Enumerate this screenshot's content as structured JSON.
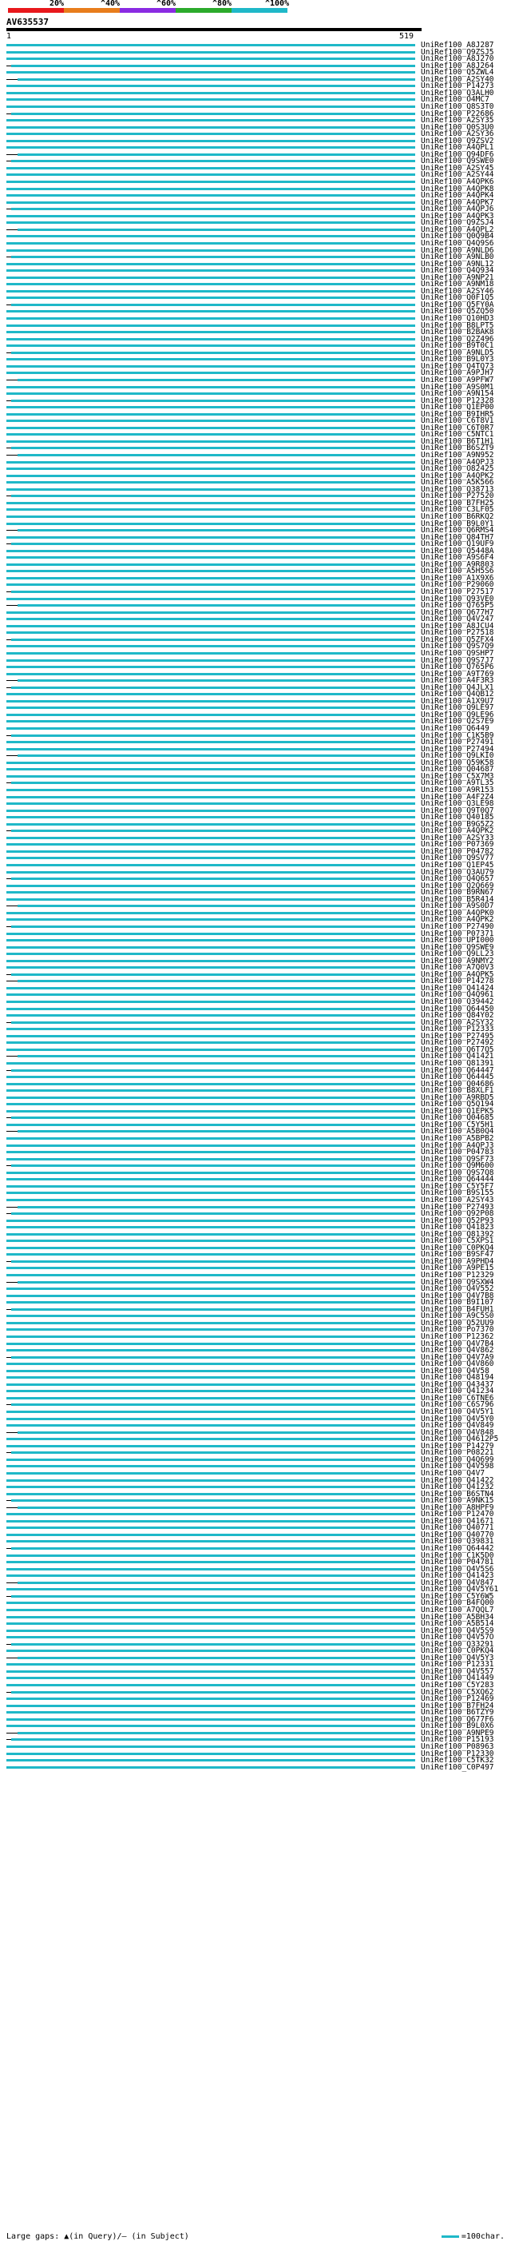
{
  "scale": {
    "labels": [
      "20%",
      "^40%",
      "^60%",
      "^80%",
      "^100%"
    ],
    "colors": [
      "#e8181c",
      "#e87d1c",
      "#8a2be2",
      "#2caa2c",
      "#1fb8c8"
    ]
  },
  "query": {
    "name": "AV635537",
    "start": "1",
    "end": "519"
  },
  "legend": {
    "large_gaps": "Large gaps: ▲(in Query)/– (in Subject)",
    "scale": "=100char."
  },
  "hits": [
    "UniRef100_A8J287",
    "UniRef100_Q9ZSJ5",
    "UniRef100_A8J270",
    "UniRef100_A8J264",
    "UniRef100_Q5ZWL4",
    "UniRef100_A2SY40",
    "UniRef100_P14273",
    "UniRef100_Q3ALH0",
    "UniRef100_O4MC7",
    "UniRef100_Q8S3T0",
    "UniRef100_P22686",
    "UniRef100_A2SY35",
    "UniRef100_Q0S3U0",
    "UniRef100_A2SY36",
    "UniRef100_Q9ZSV2",
    "UniRef100_A4QPL1",
    "UniRef100_Q94DF6",
    "UniRef100_Q9SWE0",
    "UniRef100_A2SY45",
    "UniRef100_A2SY44",
    "UniRef100_A4QPK6",
    "UniRef100_A4QPK8",
    "UniRef100_A4QPK4",
    "UniRef100_A4QPK7",
    "UniRef100_A4QPJ6",
    "UniRef100_A4QPK3",
    "UniRef100_Q9ZSJ4",
    "UniRef100_A4QPL2",
    "UniRef100_Q0Q9B4",
    "UniRef100_Q4Q9S6",
    "UniRef100_A9NLD6",
    "UniRef100_A9NLB0",
    "UniRef100_A9NL12",
    "UniRef100_Q4Q934",
    "UniRef100_A9NP21",
    "UniRef100_A9NM18",
    "UniRef100_A2SY46",
    "UniRef100_Q0F1Q5",
    "UniRef100_Q5FY0A",
    "UniRef100_Q5ZQ50",
    "UniRef100_Q10HD3",
    "UniRef100_B8LPT5",
    "UniRef100_B2BAK8",
    "UniRef100_Q2Z496",
    "UniRef100_B9T0C1",
    "UniRef100_A9NLD5",
    "UniRef100_B9L0Y3",
    "UniRef100_Q4TQ73",
    "UniRef100_A9PJH7",
    "UniRef100_A9PFW7",
    "UniRef100_A9S0M1",
    "UniRef100_A9N154",
    "UniRef100_P12328",
    "UniRef100_Q1EP00",
    "UniRef100_B9IHR5",
    "UniRef100_C6T8V1",
    "UniRef100_C6T0R7",
    "UniRef100_C5NTC1",
    "UniRef100_B6T1H1",
    "UniRef100_B6SZT9",
    "UniRef100_A9N952",
    "UniRef100_A4QPJ3",
    "UniRef100_O82425",
    "UniRef100_A4QPK2",
    "UniRef100_A5K566",
    "UniRef100_Q38713",
    "UniRef100_P27520",
    "UniRef100_B7FH25",
    "UniRef100_C3LF05",
    "UniRef100_B6RKQ2",
    "UniRef100_B9L0Y1",
    "UniRef100_Q6RMS4",
    "UniRef100_Q84TH7",
    "UniRef100_Q19UF9",
    "UniRef100_Q5448A",
    "UniRef100_A9S6F4",
    "UniRef100_A9R803",
    "UniRef100_A5H5S6",
    "UniRef100_A1X9X6",
    "UniRef100_P29060",
    "UniRef100_P27517",
    "UniRef100_Q93VE0",
    "UniRef100_Q765P5",
    "UniRef100_Q677H7",
    "UniRef100_Q4V247",
    "UniRef100_A8JCU4",
    "UniRef100_P27518",
    "UniRef100_Q5ZFX4",
    "UniRef100_Q9S7Q9",
    "UniRef100_Q9SHP7",
    "UniRef100_Q9S7J7",
    "UniRef100_Q765P6",
    "UniRef100_A9T769",
    "UniRef100_A4F3R3",
    "UniRef100_Q4JLX1",
    "UniRef100_Q4QB12",
    "UniRef100_A1X9U7",
    "UniRef100_Q9LE97",
    "UniRef100_Q9LE96",
    "UniRef100_Q2S7E9",
    "UniRef100_Q6449",
    "UniRef100_C1K5B9",
    "UniRef100_P27491",
    "UniRef100_P27494",
    "UniRef100_Q9LKI0",
    "UniRef100_Q59K58",
    "UniRef100_Q04687",
    "UniRef100_C5X7M3",
    "UniRef100_A9TL35",
    "UniRef100_A9R153",
    "UniRef100_A4F2Z4",
    "UniRef100_Q3LE98",
    "UniRef100_Q9T0Q7",
    "UniRef100_Q40185",
    "UniRef100_B9G5Z2",
    "UniRef100_A4QPK2",
    "UniRef100_A2SY33",
    "UniRef100_P07369",
    "UniRef100_P04782",
    "UniRef100_Q9SV77",
    "UniRef100_Q1EP45",
    "UniRef100_Q3AU79",
    "UniRef100_Q4Q657",
    "UniRef100_Q2Q669",
    "UniRef100_B9RN67",
    "UniRef100_B5R414",
    "UniRef100_A9S0D7",
    "UniRef100_A4QPK0",
    "UniRef100_A4QPK2",
    "UniRef100_P27490",
    "UniRef100_P07371",
    "UniRef100_UPI000",
    "UniRef100_Q9SWE9",
    "UniRef100_Q9LL23",
    "UniRef100_A9NMY2",
    "UniRef100_A7Q0V3",
    "UniRef100_A4QPK5",
    "UniRef100_P14278",
    "UniRef100_Q41424",
    "UniRef100_Q4Q961",
    "UniRef100_Q39442",
    "UniRef100_Q64450",
    "UniRef100_Q84Y02",
    "UniRef100_A2SY32",
    "UniRef100_P12333",
    "UniRef100_P27495",
    "UniRef100_P27492",
    "UniRef100_Q6T7Q5",
    "UniRef100_Q41421",
    "UniRef100_Q81391",
    "UniRef100_Q64447",
    "UniRef100_Q64445",
    "UniRef100_Q04686",
    "UniRef100_B8XLF1",
    "UniRef100_A9RBD5",
    "UniRef100_Q5Q194",
    "UniRef100_Q1EPK5",
    "UniRef100_Q04685",
    "UniRef100_C5Y5H1",
    "UniRef100_A5B0Q4",
    "UniRef100_A5BPB2",
    "UniRef100_A4QPJ3",
    "UniRef100_P04783",
    "UniRef100_Q9SF73",
    "UniRef100_Q9M600",
    "UniRef100_Q9S7Q8",
    "UniRef100_Q64444",
    "UniRef100_C5Y5F7",
    "UniRef100_B9S155",
    "UniRef100_A2SY43",
    "UniRef100_P27493",
    "UniRef100_Q92P08",
    "UniRef100_Q52P93",
    "UniRef100_Q41823",
    "UniRef100_Q81392",
    "UniRef100_C5XPS1",
    "UniRef100_C0PKQ4",
    "UniRef100_B9SF47",
    "UniRef100_A9PHD4",
    "UniRef100_A9PE15",
    "UniRef100_P12329",
    "UniRef100_Q9SXW4",
    "UniRef100_Q4V552",
    "UniRef100_Q4V7B8",
    "UniRef100_B9I107",
    "UniRef100_B4FUH1",
    "UniRef100_A9C5S0",
    "UniRef100_Q52UU9",
    "UniRef100_Po7370",
    "UniRef100_P12362",
    "UniRef100_Q4V7B4",
    "UniRef100_Q4V862",
    "UniRef100_Q4V7A9",
    "UniRef100_Q4V860",
    "UniRef100_Q4V58",
    "UniRef100_Q48194",
    "UniRef100_Q43437",
    "UniRef100_Q41234",
    "UniRef100_C6TNE6",
    "UniRef100_C6S796",
    "UniRef100_Q4V5Y1",
    "UniRef100_Q4V5Y0",
    "UniRef100_Q4V849",
    "UniRef100_Q4V848",
    "UniRef100_Q4612P5",
    "UniRef100_P14279",
    "UniRef100_P08221",
    "UniRef100_Q4Q699",
    "UniRef100_Q4V598",
    "UniRef100_Q4V7",
    "UniRef100_Q41422",
    "UniRef100_Q41232",
    "UniRef100_B6STN4",
    "UniRef100_A9NK15",
    "UniRef100_A8HPF9",
    "UniRef100_P12470",
    "UniRef100_Q41671",
    "UniRef100_Q40771",
    "UniRef100_Q40770",
    "UniRef100_Q39831",
    "UniRef100_Q64442",
    "UniRef100_C1K5D0",
    "UniRef100_P04781",
    "UniRef100_Q4V5S6",
    "UniRef100_Q41423",
    "UniRef100_Q4V847",
    "UniRef100_Q4V5Y61",
    "UniRef100_C5Y6W5",
    "UniRef100_B4FQ00",
    "UniRef100_A7QQL7",
    "UniRef100_A5BH34",
    "UniRef100_A5B514",
    "UniRef100_Q4V5S9",
    "UniRef100_Q4V57O",
    "UniRef100_Q33291",
    "UniRef100_C0PKQ4",
    "UniRef100_Q4V5Y3",
    "UniRef100_P12331",
    "UniRef100_Q4V557",
    "UniRef100_Q41449",
    "UniRef100_C5Y283",
    "UniRef100_C5XQ62",
    "UniRef100_P12469",
    "UniRef100_B7FH24",
    "UniRef100_B6TZY9",
    "UniRef100_Q677F6",
    "UniRef100_B9L0X6",
    "UniRef100_A9NPE9",
    "UniRef100_P15193",
    "UniRef100_P08963",
    "UniRef100_P12330",
    "UniRef100_C5TK32",
    "UniRef100_C0P497"
  ]
}
